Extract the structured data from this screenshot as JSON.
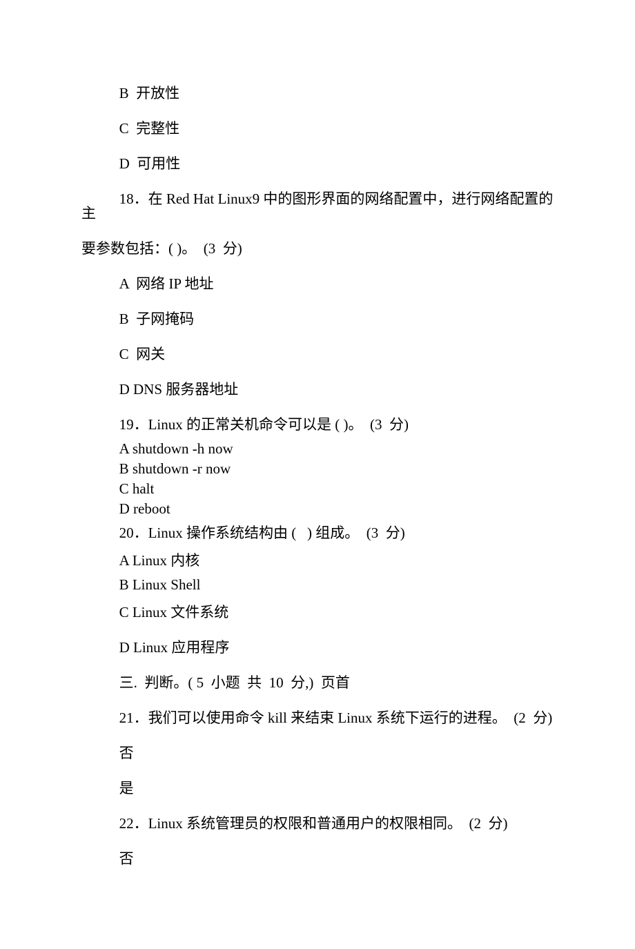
{
  "q17_optB": "B  开放性",
  "q17_optC": "C  完整性",
  "q17_optD": "D  可用性",
  "q18_line1": "18．在 Red Hat Linux9 中的图形界面的网络配置中，进行网络配置的主",
  "q18_line2": "要参数包括：( )。  (3  分)",
  "q18_optA": "A  网络 IP 地址",
  "q18_optB": "B  子网掩码",
  "q18_optC": "C  网关",
  "q18_optD": "D DNS 服务器地址",
  "q19_text": "19．Linux 的正常关机命令可以是 ( )。  (3  分)",
  "q19_optA": "A shutdown -h now",
  "q19_optB": "B shutdown -r now",
  "q19_optC": "C halt",
  "q19_optD": "D reboot",
  "q20_text": "20．Linux 操作系统结构由 (   ) 组成。  (3  分)",
  "q20_optA": "A Linux 内核",
  "q20_optB": "B Linux Shell",
  "q20_optC": "C Linux 文件系统",
  "q20_optD": "D Linux 应用程序",
  "section3": "三.  判断。( 5  小题  共  10  分,)  页首",
  "q21_text": "21．我们可以使用命令 kill 来结束 Linux 系统下运行的进程。  (2  分)",
  "q21_no": "否",
  "q21_yes": "是",
  "q22_text": "22．Linux 系统管理员的权限和普通用户的权限相同。  (2  分)",
  "q22_no": "否"
}
